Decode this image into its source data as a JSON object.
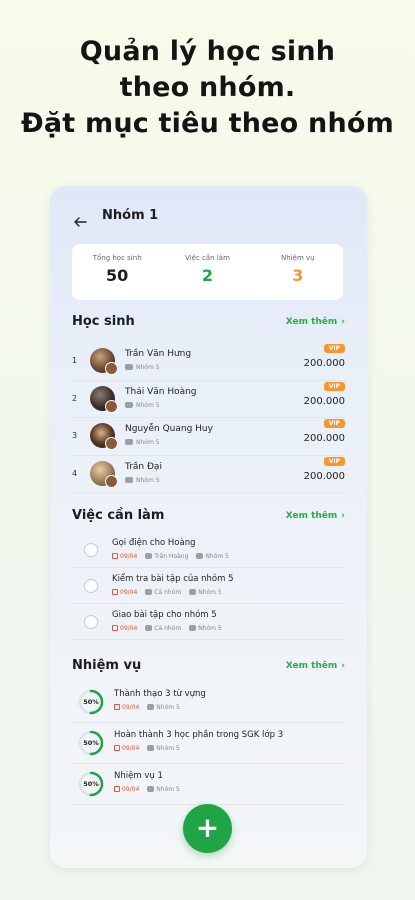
{
  "headline": [
    "Quản lý học sinh",
    "theo nhóm.",
    "Đặt mục tiêu theo nhóm"
  ],
  "group_title": "Nhóm 1",
  "stats": [
    {
      "label": "Tổng học sinh",
      "value": "50",
      "color": "#1d1d1f"
    },
    {
      "label": "Việc cần làm",
      "value": "2",
      "color": "#1fa545"
    },
    {
      "label": "Nhiệm vụ",
      "value": "3",
      "color": "#f5972a"
    }
  ],
  "students_section": {
    "title": "Học sinh",
    "see_more": "Xem thêm",
    "items": [
      {
        "index": "1",
        "name": "Trần Văn Hưng",
        "group": "Nhóm 5",
        "badge": "VIP",
        "price": "200.000"
      },
      {
        "index": "2",
        "name": "Thái Văn Hoàng",
        "group": "Nhóm 5",
        "badge": "VIP",
        "price": "200.000"
      },
      {
        "index": "3",
        "name": "Nguyễn Quang Huy",
        "group": "Nhóm 5",
        "badge": "VIP",
        "price": "200.000"
      },
      {
        "index": "4",
        "name": "Trần Đại",
        "group": "Nhóm 5",
        "badge": "VIP",
        "price": "200.000"
      }
    ]
  },
  "todos_section": {
    "title": "Việc cần làm",
    "see_more": "Xem thêm",
    "items": [
      {
        "title": "Gọi điện cho Hoàng",
        "date": "09/04",
        "person": "Trần Hoàng",
        "group": "Nhóm 5"
      },
      {
        "title": "Kiểm tra bài tập của nhóm 5",
        "date": "09/04",
        "person": "Cả nhóm",
        "group": "Nhóm 5"
      },
      {
        "title": "Giao bài tập cho nhóm 5",
        "date": "09/04",
        "person": "Cả nhóm",
        "group": "Nhóm 5"
      }
    ]
  },
  "tasks_section": {
    "title": "Nhiệm vụ",
    "see_more": "Xem thêm",
    "items": [
      {
        "title": "Thành thạo 3 từ vựng",
        "progress_label": "50%",
        "progress": 0.5,
        "date": "09/04",
        "group": "Nhóm 5"
      },
      {
        "title": "Hoàn thành 3 học phần trong SGK lớp 3",
        "progress_label": "50%",
        "progress": 0.5,
        "date": "09/04",
        "group": "Nhóm 5"
      },
      {
        "title": "Nhiệm vụ 1",
        "progress_label": "50%",
        "progress": 0.5,
        "date": "09/04",
        "group": "Nhóm 5"
      }
    ]
  },
  "fab_label": "+",
  "colors": {
    "accent": "#1fa545",
    "vip": "#f5972a",
    "date": "#e2583e"
  }
}
